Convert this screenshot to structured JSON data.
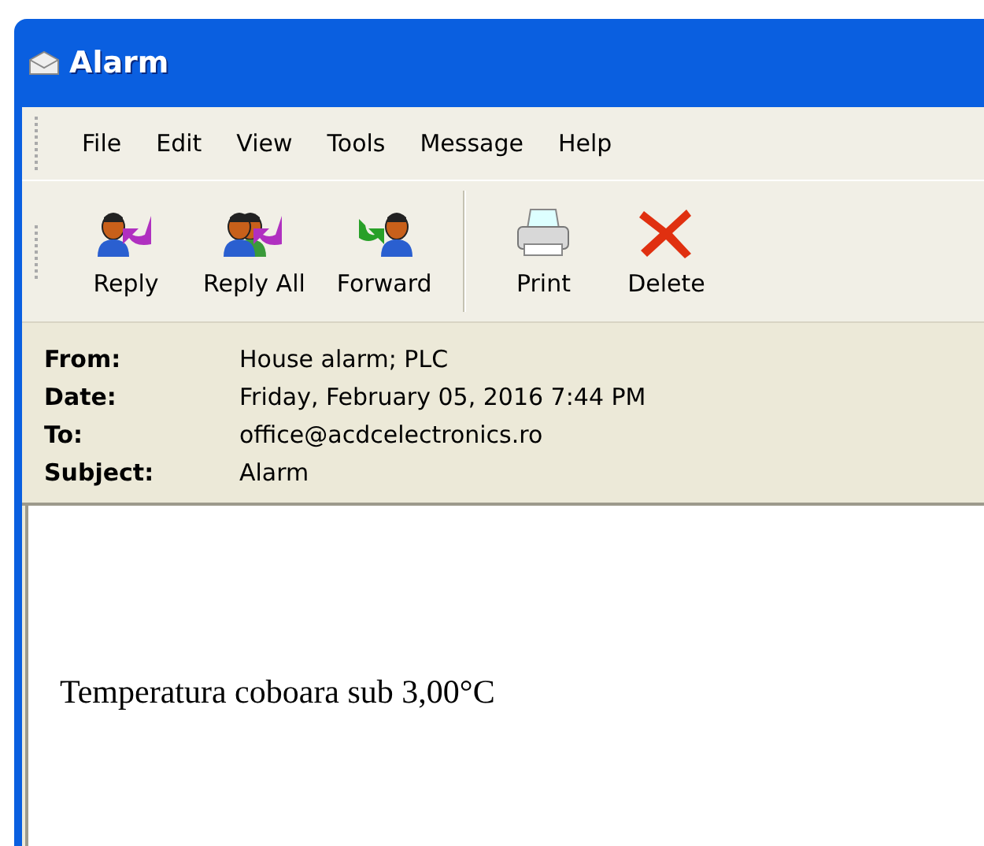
{
  "window": {
    "title": "Alarm"
  },
  "menu": [
    "File",
    "Edit",
    "View",
    "Tools",
    "Message",
    "Help"
  ],
  "toolbar": {
    "groups": [
      [
        {
          "label": "Reply",
          "kind": "reply"
        },
        {
          "label": "Reply All",
          "kind": "reply_all"
        },
        {
          "label": "Forward",
          "kind": "forward"
        }
      ],
      [
        {
          "label": "Print",
          "kind": "print"
        },
        {
          "label": "Delete",
          "kind": "delete"
        }
      ]
    ]
  },
  "header": [
    {
      "label": "From:",
      "value": "House alarm; PLC"
    },
    {
      "label": "Date:",
      "value": "Friday, February 05, 2016 7:44 PM"
    },
    {
      "label": "To:",
      "value": "office@acdcelectronics.ro"
    },
    {
      "label": "Subject:",
      "value": "Alarm"
    }
  ],
  "body": {
    "text": "Temperatura coboara sub 3,00°C"
  }
}
